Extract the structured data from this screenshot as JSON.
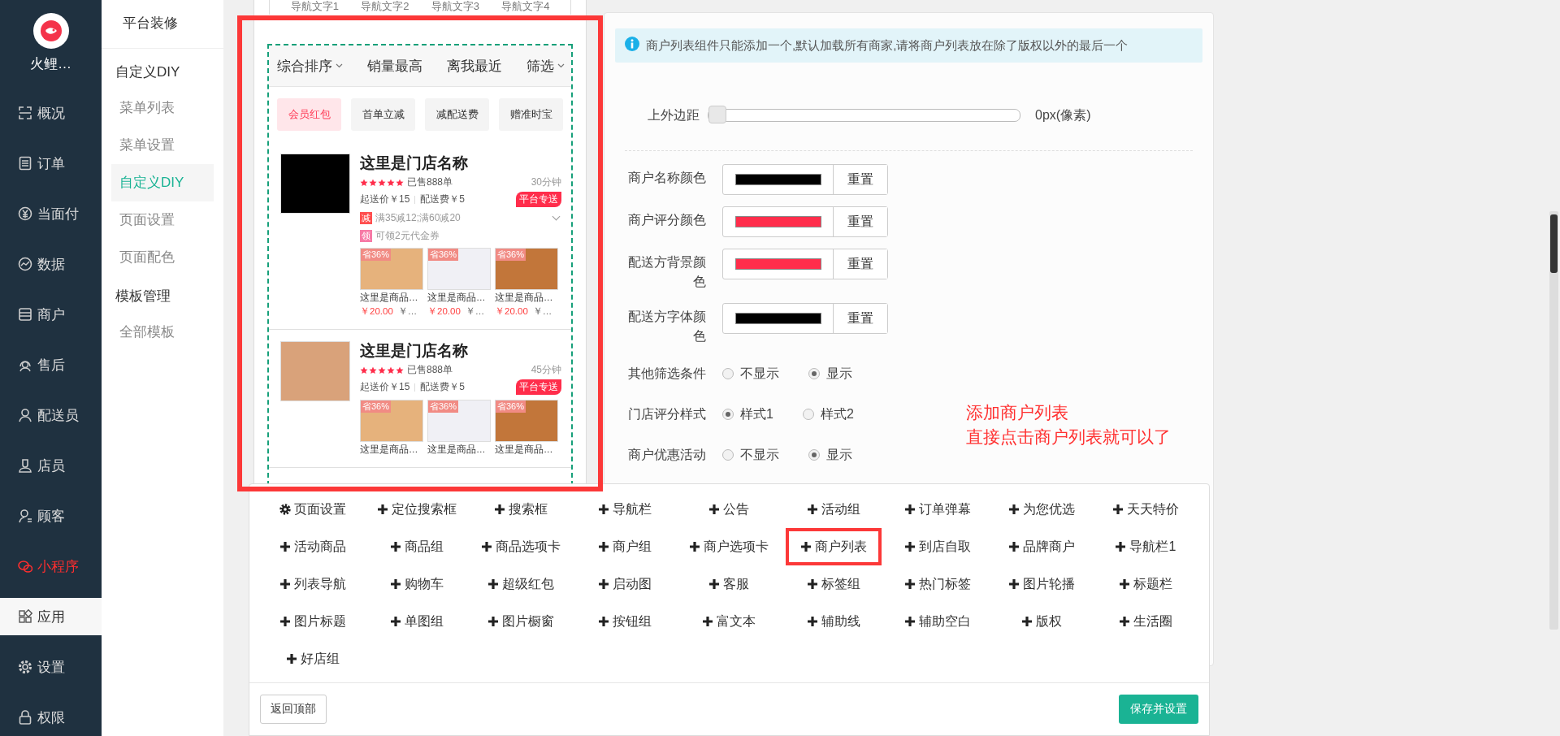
{
  "nav": {
    "logo_text": "火鲤…",
    "items": [
      {
        "label": "概况",
        "selected": false,
        "highlighted": false
      },
      {
        "label": "订单",
        "selected": false,
        "highlighted": false
      },
      {
        "label": "当面付",
        "selected": false,
        "highlighted": false
      },
      {
        "label": "数据",
        "selected": false,
        "highlighted": false
      },
      {
        "label": "商户",
        "selected": false,
        "highlighted": false
      },
      {
        "label": "售后",
        "selected": false,
        "highlighted": false
      },
      {
        "label": "配送员",
        "selected": false,
        "highlighted": false
      },
      {
        "label": "店员",
        "selected": false,
        "highlighted": false
      },
      {
        "label": "顾客",
        "selected": false,
        "highlighted": false
      },
      {
        "label": "小程序",
        "selected": false,
        "highlighted": true
      },
      {
        "label": "应用",
        "selected": true,
        "highlighted": false
      },
      {
        "label": "设置",
        "selected": false,
        "highlighted": false
      },
      {
        "label": "权限",
        "selected": false,
        "highlighted": false
      }
    ]
  },
  "submenu": {
    "title": "平台装修",
    "groups": [
      {
        "title": "自定义DIY",
        "items": [
          {
            "label": "菜单列表",
            "selected": false
          },
          {
            "label": "菜单设置",
            "selected": false
          },
          {
            "label": "自定义DIY",
            "selected": true
          },
          {
            "label": "页面设置",
            "selected": false
          },
          {
            "label": "页面配色",
            "selected": false
          }
        ]
      },
      {
        "title": "模板管理",
        "items": [
          {
            "label": "全部模板",
            "selected": false
          }
        ]
      }
    ]
  },
  "preview": {
    "nav_tabs": [
      "导航文字1",
      "导航文字2",
      "导航文字3",
      "导航文字4"
    ],
    "sort_tabs": [
      {
        "label": "综合排序",
        "caret": true
      },
      {
        "label": "销量最高",
        "caret": false
      },
      {
        "label": "离我最近",
        "caret": false
      },
      {
        "label": "筛选",
        "caret": true
      }
    ],
    "filters": [
      {
        "label": "会员红包",
        "selected": true
      },
      {
        "label": "首单立减",
        "selected": false
      },
      {
        "label": "减配送费",
        "selected": false
      },
      {
        "label": "赠准时宝",
        "selected": false
      }
    ],
    "stores": [
      {
        "kind": "logo",
        "name": "这里是门店名称",
        "stars": 5,
        "sold": "已售888单",
        "time": "30分钟",
        "min_order": "起送价￥15",
        "fee": "配送费￥5",
        "tag": "平台专送",
        "promotions": [
          {
            "badge": "减",
            "color": "#ff4f4f",
            "text": "满35减12;满60减20",
            "expandable": true
          },
          {
            "badge": "领",
            "color": "#f77aa6",
            "text": "可领2元代金券",
            "expandable": false
          }
        ],
        "products": [
          {
            "badge": "省36%",
            "name": "这里是商品…",
            "price": "￥20.00",
            "old_price": "￥…"
          },
          {
            "badge": "省36%",
            "name": "这里是商品…",
            "price": "￥20.00",
            "old_price": "￥…"
          },
          {
            "badge": "省36%",
            "name": "这里是商品…",
            "price": "￥20.00",
            "old_price": "￥…"
          }
        ]
      },
      {
        "kind": "photo",
        "name": "这里是门店名称",
        "stars": 5,
        "sold": "已售888单",
        "time": "45分钟",
        "min_order": "起送价￥15",
        "fee": "配送费￥5",
        "tag": "平台专送",
        "products": [
          {
            "badge": "省36%",
            "name": "这里是商品…"
          },
          {
            "badge": "省36%",
            "name": "这里是商品…"
          },
          {
            "badge": "省36%",
            "name": "这里是商品…"
          }
        ]
      }
    ]
  },
  "settings": {
    "notice": "商户列表组件只能添加一个,默认加载所有商家,请将商户列表放在除了版权以外的最后一个",
    "slider": {
      "label": "上外边距",
      "level": 0,
      "reading": "0px(像素)"
    },
    "colors": [
      {
        "label": "商户名称颜色",
        "color": "#000000",
        "reset": "重置"
      },
      {
        "label": "商户评分颜色",
        "color": "#ff2d4b",
        "reset": "重置"
      },
      {
        "label": "配送方背景颜色",
        "color": "#ff2d4b",
        "reset": "重置"
      },
      {
        "label": "配送方字体颜色",
        "color": "#000000",
        "reset": "重置"
      }
    ],
    "radios": [
      {
        "label": "其他筛选条件",
        "options": [
          {
            "label": "不显示",
            "selected": false
          },
          {
            "label": "显示",
            "selected": true
          }
        ]
      },
      {
        "label": "门店评分样式",
        "options": [
          {
            "label": "样式1",
            "selected": true
          },
          {
            "label": "样式2",
            "selected": false
          }
        ]
      },
      {
        "label": "商户优惠活动",
        "options": [
          {
            "label": "不显示",
            "selected": false
          },
          {
            "label": "显示",
            "selected": true
          }
        ]
      }
    ]
  },
  "annotation": [
    "添加商户列表",
    "直接点击商户列表就可以了"
  ],
  "palette": {
    "items": [
      {
        "kind": "settings",
        "label": "页面设置",
        "highlighted": false
      },
      {
        "kind": "add",
        "label": "定位搜索框",
        "highlighted": false
      },
      {
        "kind": "add",
        "label": "搜索框",
        "highlighted": false
      },
      {
        "kind": "add",
        "label": "导航栏",
        "highlighted": false
      },
      {
        "kind": "add",
        "label": "公告",
        "highlighted": false
      },
      {
        "kind": "add",
        "label": "活动组",
        "highlighted": false
      },
      {
        "kind": "add",
        "label": "订单弹幕",
        "highlighted": false
      },
      {
        "kind": "add",
        "label": "为您优选",
        "highlighted": false
      },
      {
        "kind": "add",
        "label": "天天特价",
        "highlighted": false
      },
      {
        "kind": "add",
        "label": "活动商品",
        "highlighted": false
      },
      {
        "kind": "add",
        "label": "商品组",
        "highlighted": false
      },
      {
        "kind": "add",
        "label": "商品选项卡",
        "highlighted": false
      },
      {
        "kind": "add",
        "label": "商户组",
        "highlighted": false
      },
      {
        "kind": "add",
        "label": "商户选项卡",
        "highlighted": false
      },
      {
        "kind": "add",
        "label": "商户列表",
        "highlighted": true
      },
      {
        "kind": "add",
        "label": "到店自取",
        "highlighted": false
      },
      {
        "kind": "add",
        "label": "品牌商户",
        "highlighted": false
      },
      {
        "kind": "add",
        "label": "导航栏1",
        "highlighted": false
      },
      {
        "kind": "add",
        "label": "列表导航",
        "highlighted": false
      },
      {
        "kind": "add",
        "label": "购物车",
        "highlighted": false
      },
      {
        "kind": "add",
        "label": "超级红包",
        "highlighted": false
      },
      {
        "kind": "add",
        "label": "启动图",
        "highlighted": false
      },
      {
        "kind": "add",
        "label": "客服",
        "highlighted": false
      },
      {
        "kind": "add",
        "label": "标签组",
        "highlighted": false
      },
      {
        "kind": "add",
        "label": "热门标签",
        "highlighted": false
      },
      {
        "kind": "add",
        "label": "图片轮播",
        "highlighted": false
      },
      {
        "kind": "add",
        "label": "标题栏",
        "highlighted": false
      },
      {
        "kind": "add",
        "label": "图片标题",
        "highlighted": false
      },
      {
        "kind": "add",
        "label": "单图组",
        "highlighted": false
      },
      {
        "kind": "add",
        "label": "图片橱窗",
        "highlighted": false
      },
      {
        "kind": "add",
        "label": "按钮组",
        "highlighted": false
      },
      {
        "kind": "add",
        "label": "富文本",
        "highlighted": false
      },
      {
        "kind": "add",
        "label": "辅助线",
        "highlighted": false
      },
      {
        "kind": "add",
        "label": "辅助空白",
        "highlighted": false
      },
      {
        "kind": "add",
        "label": "版权",
        "highlighted": false
      },
      {
        "kind": "add",
        "label": "生活圈",
        "highlighted": false
      },
      {
        "kind": "add",
        "label": "好店组",
        "highlighted": false
      }
    ],
    "back_top": "返回顶部",
    "save": "保存并设置"
  }
}
